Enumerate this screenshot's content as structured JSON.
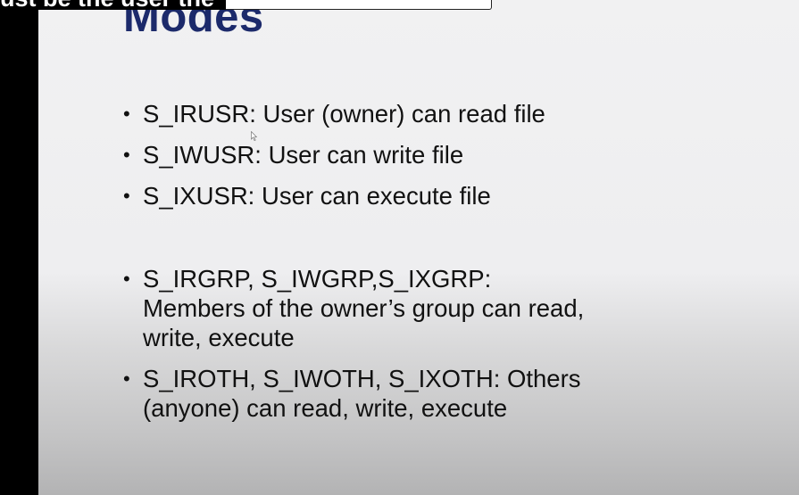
{
  "caption": {
    "text": "ust be the user the"
  },
  "slide": {
    "title": "Modes",
    "bullets": [
      {
        "text": "S_IRUSR: User (owner) can read file"
      },
      {
        "text": "S_IWUSR: User can write file"
      },
      {
        "text": "S_IXUSR: User can execute file"
      },
      {
        "text": "S_IRGRP, S_IWGRP,S_IXGRP: Members of the owner’s group can read, write, execute"
      },
      {
        "text": "S_IROTH, S_IWOTH, S_IXOTH: Others (anyone) can read, write, execute"
      }
    ],
    "bullet_symbol": "•"
  },
  "colors": {
    "title": "#1c2a6b",
    "text": "#111111",
    "left_bar": "#000000"
  },
  "icons": [
    "mouse-cursor-icon"
  ]
}
